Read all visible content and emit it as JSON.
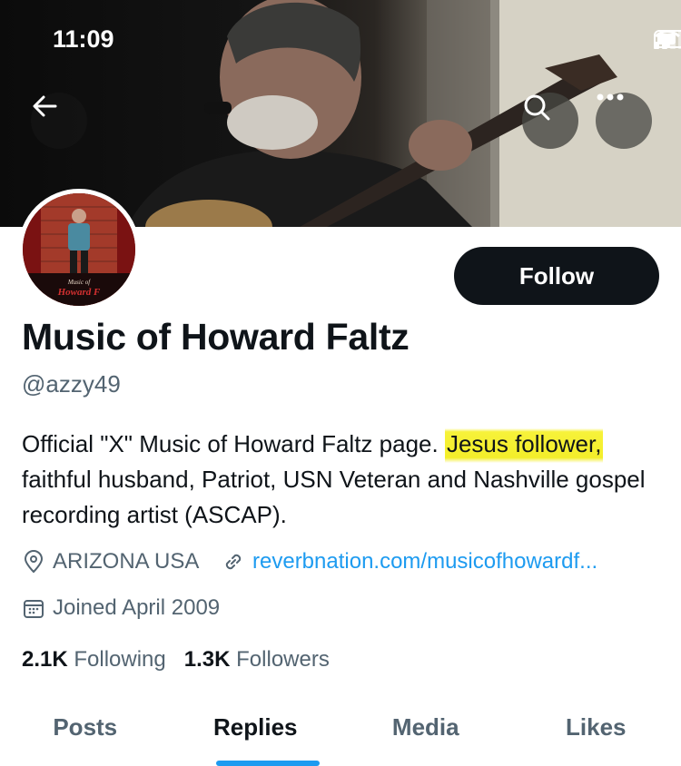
{
  "status_bar": {
    "time": "11:09"
  },
  "header_actions": {
    "back_icon": "arrow-left-icon",
    "search_icon": "search-icon",
    "more_icon": "more-horizontal-icon"
  },
  "avatar": {
    "caption_line1": "Music of",
    "caption_line2": "Howard F"
  },
  "follow_label": "Follow",
  "profile": {
    "display_name": "Music of Howard Faltz",
    "handle": "@azzy49",
    "bio_before": "Official \"X\" Music of Howard Faltz page. ",
    "bio_highlight": "Jesus follower,",
    "bio_after": " faithful husband, Patriot, USN Veteran and Nashville gospel recording artist (ASCAP).",
    "location": "ARIZONA USA",
    "link": "reverbnation.com/musicofhowardf...",
    "joined": "Joined April 2009"
  },
  "stats": {
    "following_count": "2.1K",
    "following_label": "Following",
    "followers_count": "1.3K",
    "followers_label": "Followers"
  },
  "tabs": [
    {
      "label": "Posts"
    },
    {
      "label": "Replies"
    },
    {
      "label": "Media"
    },
    {
      "label": "Likes"
    }
  ],
  "active_tab": "Replies",
  "colors": {
    "accent": "#1d9bf0",
    "highlight": "#f3ee2a",
    "text": "#0f1419",
    "muted": "#536471"
  }
}
